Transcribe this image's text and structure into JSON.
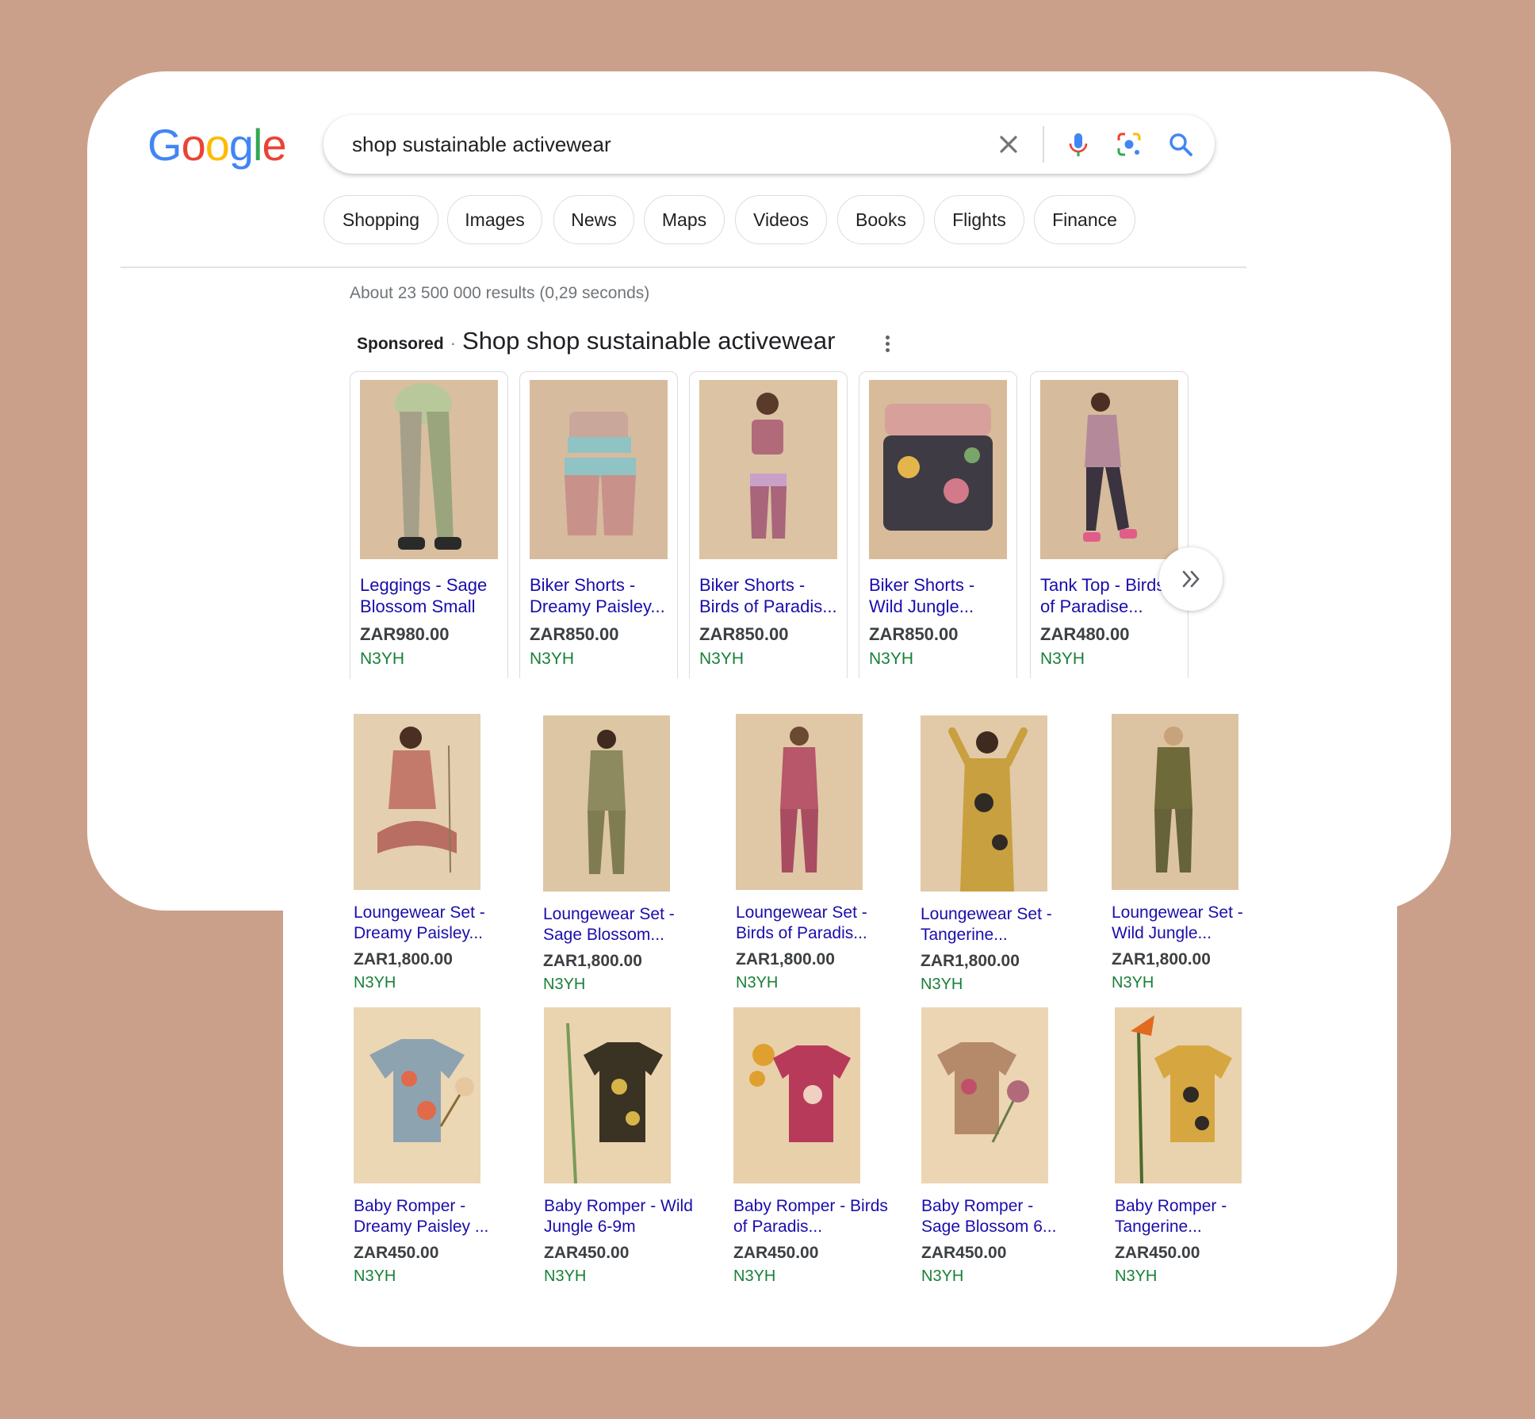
{
  "logo": {
    "letters": [
      "G",
      "o",
      "o",
      "g",
      "l",
      "e"
    ],
    "colors": [
      "#4285f4",
      "#ea4335",
      "#fbbc05",
      "#4285f4",
      "#34a853",
      "#ea4335"
    ]
  },
  "search": {
    "query": "shop sustainable activewear"
  },
  "chips": [
    "Shopping",
    "Images",
    "News",
    "Maps",
    "Videos",
    "Books",
    "Flights",
    "Finance"
  ],
  "result_stats": "About 23 500 000 results (0,29 seconds)",
  "sponsored": {
    "label": "Sponsored",
    "separator": "·",
    "title": "Shop shop sustainable activewear"
  },
  "carousel": [
    {
      "name": "Leggings - Sage Blossom Small",
      "price": "ZAR980.00",
      "seller": "N3YH"
    },
    {
      "name": "Biker Shorts - Dreamy Paisley...",
      "price": "ZAR850.00",
      "seller": "N3YH"
    },
    {
      "name": "Biker Shorts - Birds of Paradis...",
      "price": "ZAR850.00",
      "seller": "N3YH"
    },
    {
      "name": "Biker Shorts - Wild Jungle...",
      "price": "ZAR850.00",
      "seller": "N3YH"
    },
    {
      "name": "Tank Top - Birds of Paradise...",
      "price": "ZAR480.00",
      "seller": "N3YH"
    }
  ],
  "grid_row1": [
    {
      "name": "Loungewear Set - Dreamy Paisley...",
      "price": "ZAR1,800.00",
      "seller": "N3YH"
    },
    {
      "name": "Loungewear Set - Sage Blossom...",
      "price": "ZAR1,800.00",
      "seller": "N3YH"
    },
    {
      "name": "Loungewear Set - Birds of Paradis...",
      "price": "ZAR1,800.00",
      "seller": "N3YH"
    },
    {
      "name": "Loungewear Set - Tangerine...",
      "price": "ZAR1,800.00",
      "seller": "N3YH"
    },
    {
      "name": "Loungewear Set - Wild Jungle...",
      "price": "ZAR1,800.00",
      "seller": "N3YH"
    }
  ],
  "grid_row2": [
    {
      "name": "Baby Romper - Dreamy Paisley ...",
      "price": "ZAR450.00",
      "seller": "N3YH"
    },
    {
      "name": "Baby Romper - Wild Jungle 6-9m",
      "price": "ZAR450.00",
      "seller": "N3YH"
    },
    {
      "name": "Baby Romper - Birds of Paradis...",
      "price": "ZAR450.00",
      "seller": "N3YH"
    },
    {
      "name": "Baby Romper - Sage Blossom 6...",
      "price": "ZAR450.00",
      "seller": "N3YH"
    },
    {
      "name": "Baby Romper - Tangerine...",
      "price": "ZAR450.00",
      "seller": "N3YH"
    }
  ],
  "colors": {
    "link": "#1a0dab",
    "seller": "#188038",
    "background": "#cba08a"
  }
}
